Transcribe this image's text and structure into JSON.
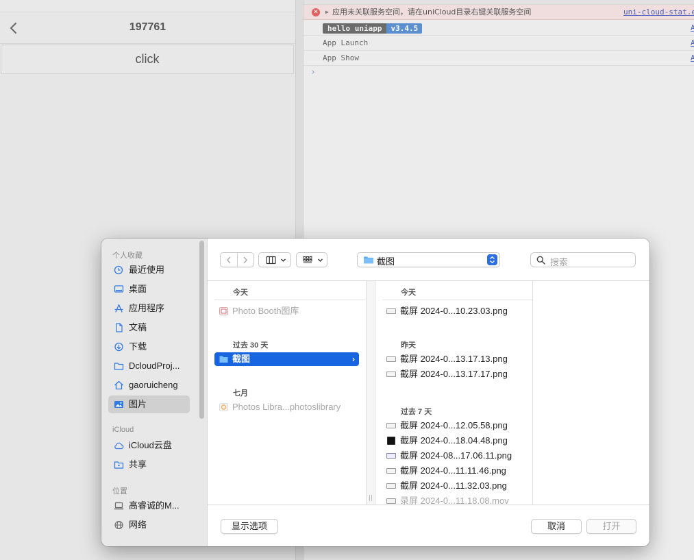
{
  "simulator": {
    "title": "197761",
    "button_label": "click"
  },
  "console": {
    "error_text": "应用未关联服务空间，请在uniCloud目录右键关联服务空间",
    "error_link": "uni-cloud-stat.e",
    "badge_name": "hello uniapp",
    "badge_version": "v3.4.5",
    "lines": [
      "App Launch",
      "App Show"
    ],
    "side_link": "A",
    "prompt": "›"
  },
  "dialog": {
    "sidebar": {
      "favorites_label": "个人收藏",
      "favorites": [
        {
          "label": "最近使用",
          "icon": "clock-icon"
        },
        {
          "label": "桌面",
          "icon": "desktop-icon"
        },
        {
          "label": "应用程序",
          "icon": "applications-icon"
        },
        {
          "label": "文稿",
          "icon": "document-icon"
        },
        {
          "label": "下载",
          "icon": "download-icon"
        },
        {
          "label": "DcloudProj...",
          "icon": "folder-icon"
        },
        {
          "label": "gaoruicheng",
          "icon": "home-icon"
        },
        {
          "label": "图片",
          "icon": "pictures-icon"
        }
      ],
      "icloud_label": "iCloud",
      "icloud": [
        {
          "label": "iCloud云盘",
          "icon": "cloud-icon"
        },
        {
          "label": "共享",
          "icon": "shared-folder-icon"
        }
      ],
      "locations_label": "位置",
      "locations": [
        {
          "label": "高睿诚的M...",
          "icon": "laptop-icon"
        },
        {
          "label": "网络",
          "icon": "network-icon"
        }
      ]
    },
    "toolbar": {
      "path": "截图",
      "search_placeholder": "搜索"
    },
    "column1": {
      "groups": [
        {
          "label": "今天",
          "items": [
            {
              "label": "Photo Booth图库",
              "dim": true
            }
          ]
        },
        {
          "label": "过去 30 天",
          "items": [
            {
              "label": "截图",
              "selected": true
            }
          ]
        },
        {
          "label": "七月",
          "items": [
            {
              "label": "Photos Libra...photoslibrary",
              "dim": true
            }
          ]
        }
      ]
    },
    "column2": {
      "groups": [
        {
          "label": "今天",
          "items": [
            "截屏 2024-0...10.23.03.png"
          ]
        },
        {
          "label": "昨天",
          "items": [
            "截屏 2024-0...13.17.13.png",
            "截屏 2024-0...13.17.17.png"
          ]
        },
        {
          "label": "过去 7 天",
          "items": [
            "截屏 2024-0...12.05.58.png",
            "截屏 2024-0...18.04.48.png",
            "截屏 2024-08...17.06.11.png",
            "截屏 2024-0...11.11.46.png",
            "截屏 2024-0...11.32.03.png",
            "录屏 2024-0...11.18.08.mov"
          ]
        }
      ]
    },
    "footer": {
      "options_label": "显示选项",
      "cancel_label": "取消",
      "open_label": "打开"
    }
  }
}
